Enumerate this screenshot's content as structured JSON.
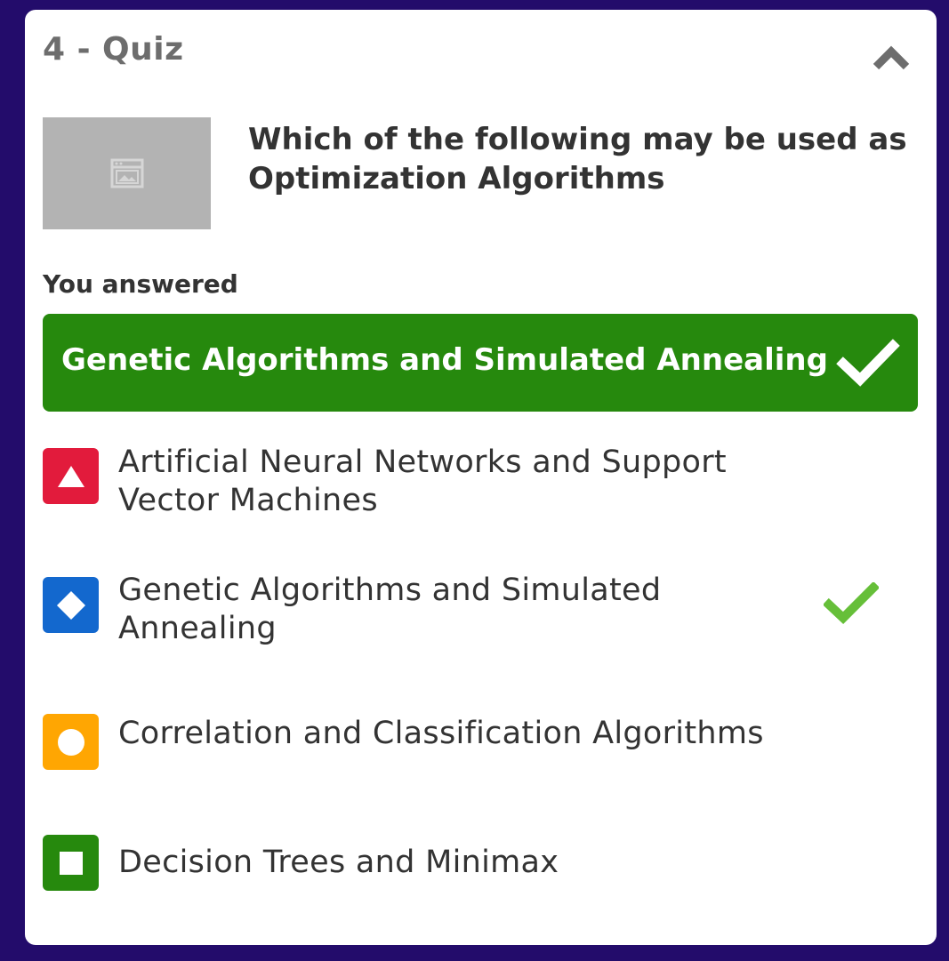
{
  "quiz": {
    "title": "4 - Quiz",
    "question": "Which of the following may be used as Optimization Algorithms",
    "answered_label": "You answered",
    "answered_value": "Genetic Algorithms and Simulated Annealing",
    "image_icon": "image-placeholder-icon",
    "collapse_icon": "chevron-up-icon"
  },
  "options": [
    {
      "shape": "triangle",
      "color": "#e21b3c",
      "label": "Artificial Neural Networks and Support Vector Machines",
      "correct": false
    },
    {
      "shape": "diamond",
      "color": "#1368ce",
      "label": "Genetic Algorithms and Simulated Annealing",
      "correct": true
    },
    {
      "shape": "circle",
      "color": "#ffa602",
      "label": "Correlation and Classification Algorithms",
      "correct": false
    },
    {
      "shape": "square",
      "color": "#26890d",
      "label": "Decision Trees and Minimax",
      "correct": false
    }
  ],
  "colors": {
    "background": "#230c6b",
    "answered_green": "#26890d",
    "check_green": "#66bf39"
  }
}
